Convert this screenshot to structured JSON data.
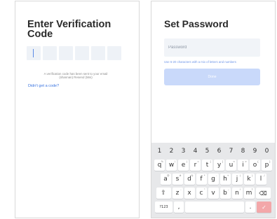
{
  "verification": {
    "title": "Enter Verification\nCode",
    "code_boxes": [
      "",
      "",
      "",
      "",
      "",
      ""
    ],
    "sent_note": "A verification code has been sent to your email\n(shannan) Resend (56s)",
    "no_code_link": "Didn't get a code?"
  },
  "set_password": {
    "title": "Set Password",
    "password_placeholder": "Password",
    "hint": "Use 6-20 characters with a mix of letters and numbers",
    "done_label": "Done"
  },
  "keyboard": {
    "number_row": [
      "1",
      "2",
      "3",
      "4",
      "5",
      "6",
      "7",
      "8",
      "9",
      "0"
    ],
    "row1": [
      {
        "key": "q",
        "hint": "%"
      },
      {
        "key": "w",
        "hint": "\\"
      },
      {
        "key": "e",
        "hint": "|"
      },
      {
        "key": "r",
        "hint": "="
      },
      {
        "key": "t",
        "hint": "["
      },
      {
        "key": "y",
        "hint": "]"
      },
      {
        "key": "u",
        "hint": "<"
      },
      {
        "key": "i",
        "hint": ">"
      },
      {
        "key": "o",
        "hint": "{"
      },
      {
        "key": "p",
        "hint": "}"
      }
    ],
    "row2": [
      {
        "key": "a",
        "hint": "@"
      },
      {
        "key": "s",
        "hint": "#"
      },
      {
        "key": "d",
        "hint": "&"
      },
      {
        "key": "f",
        "hint": "*"
      },
      {
        "key": "g",
        "hint": "-"
      },
      {
        "key": "h",
        "hint": "+"
      },
      {
        "key": "j",
        "hint": "("
      },
      {
        "key": "k",
        "hint": ")"
      },
      {
        "key": "l",
        "hint": "/"
      }
    ],
    "row3": [
      {
        "key": "z",
        "hint": "-"
      },
      {
        "key": "x",
        "hint": ""
      },
      {
        "key": "c",
        "hint": "\""
      },
      {
        "key": "v",
        "hint": ""
      },
      {
        "key": "b",
        "hint": ";"
      },
      {
        "key": "n",
        "hint": "!"
      },
      {
        "key": "m",
        "hint": "?"
      }
    ],
    "shift_icon": "shift-icon",
    "backspace_icon": "backspace-icon",
    "symbols_label": "?123",
    "comma_label": ",",
    "period_label": ".",
    "enter_icon": "checkmark-icon",
    "enter_color": "#f3a7a9"
  }
}
